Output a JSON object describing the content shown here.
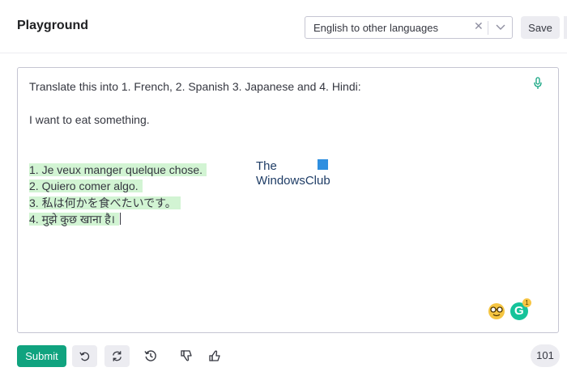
{
  "header": {
    "title": "Playground",
    "preset": "English to other languages",
    "save_label": "Save"
  },
  "editor": {
    "prompt": "Translate this into 1. French, 2. Spanish 3. Japanese and 4. Hindi:",
    "input_sentence": "I want to eat something.",
    "completions": [
      "1. Je veux manger quelque chose.",
      "2. Quiero comer algo.",
      "3. 私は何かを食べたいです。",
      "4. मुझे कुछ खाना है।"
    ],
    "grammarly_badge": "1"
  },
  "watermark": {
    "line1": "The",
    "line2": "WindowsClub"
  },
  "footer": {
    "submit_label": "Submit",
    "token_count": "101"
  }
}
